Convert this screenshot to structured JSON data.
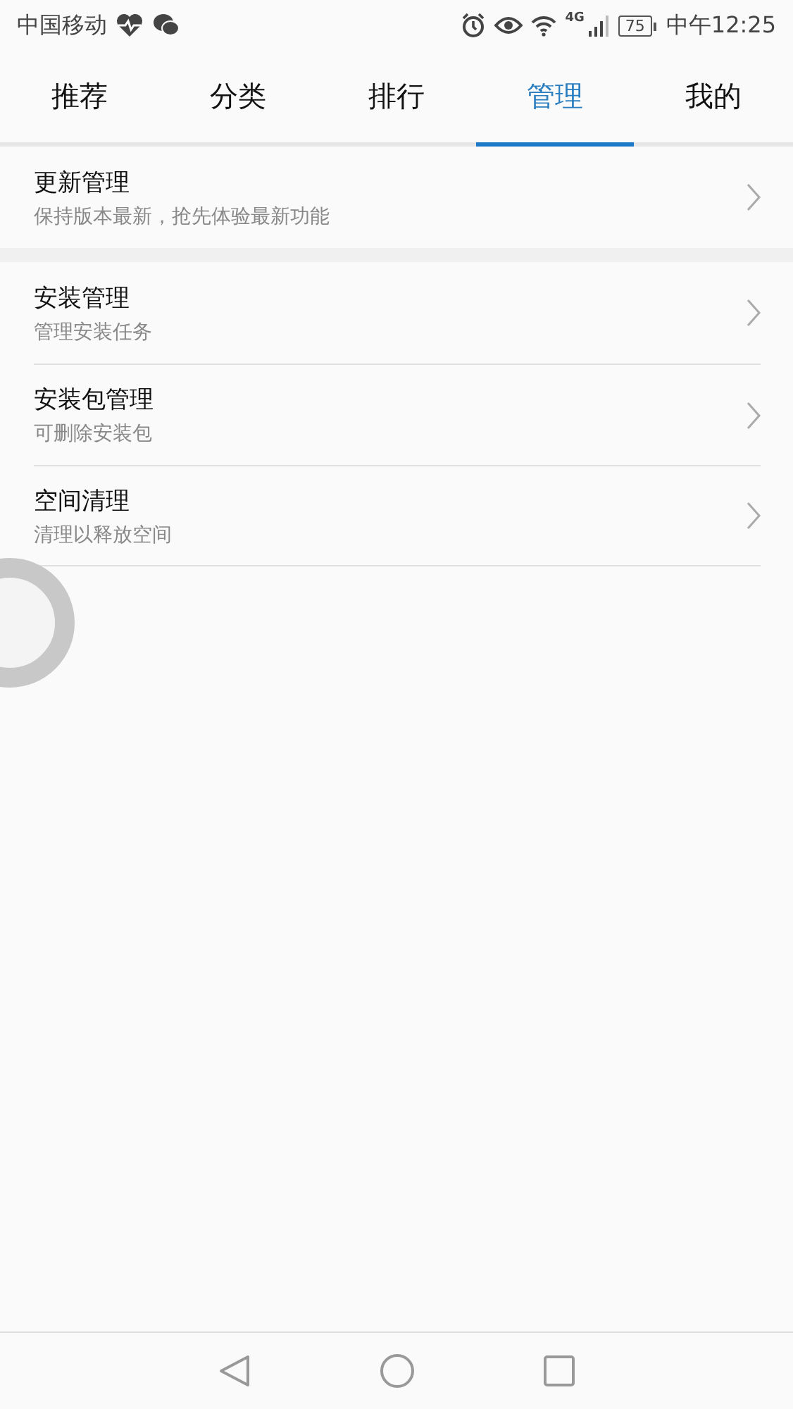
{
  "status_bar": {
    "carrier": "中国移动",
    "network": "4G",
    "battery": "75",
    "time": "中午12:25"
  },
  "tabs": [
    {
      "label": "推荐",
      "selected": false
    },
    {
      "label": "分类",
      "selected": false
    },
    {
      "label": "排行",
      "selected": false
    },
    {
      "label": "管理",
      "selected": true
    },
    {
      "label": "我的",
      "selected": false
    }
  ],
  "sections": [
    {
      "items": [
        {
          "title": "更新管理",
          "subtitle": "保持版本最新，抢先体验最新功能"
        }
      ]
    },
    {
      "items": [
        {
          "title": "安装管理",
          "subtitle": "管理安装任务"
        },
        {
          "title": "安装包管理",
          "subtitle": "可删除安装包"
        },
        {
          "title": "空间清理",
          "subtitle": "清理以释放空间"
        }
      ]
    }
  ]
}
